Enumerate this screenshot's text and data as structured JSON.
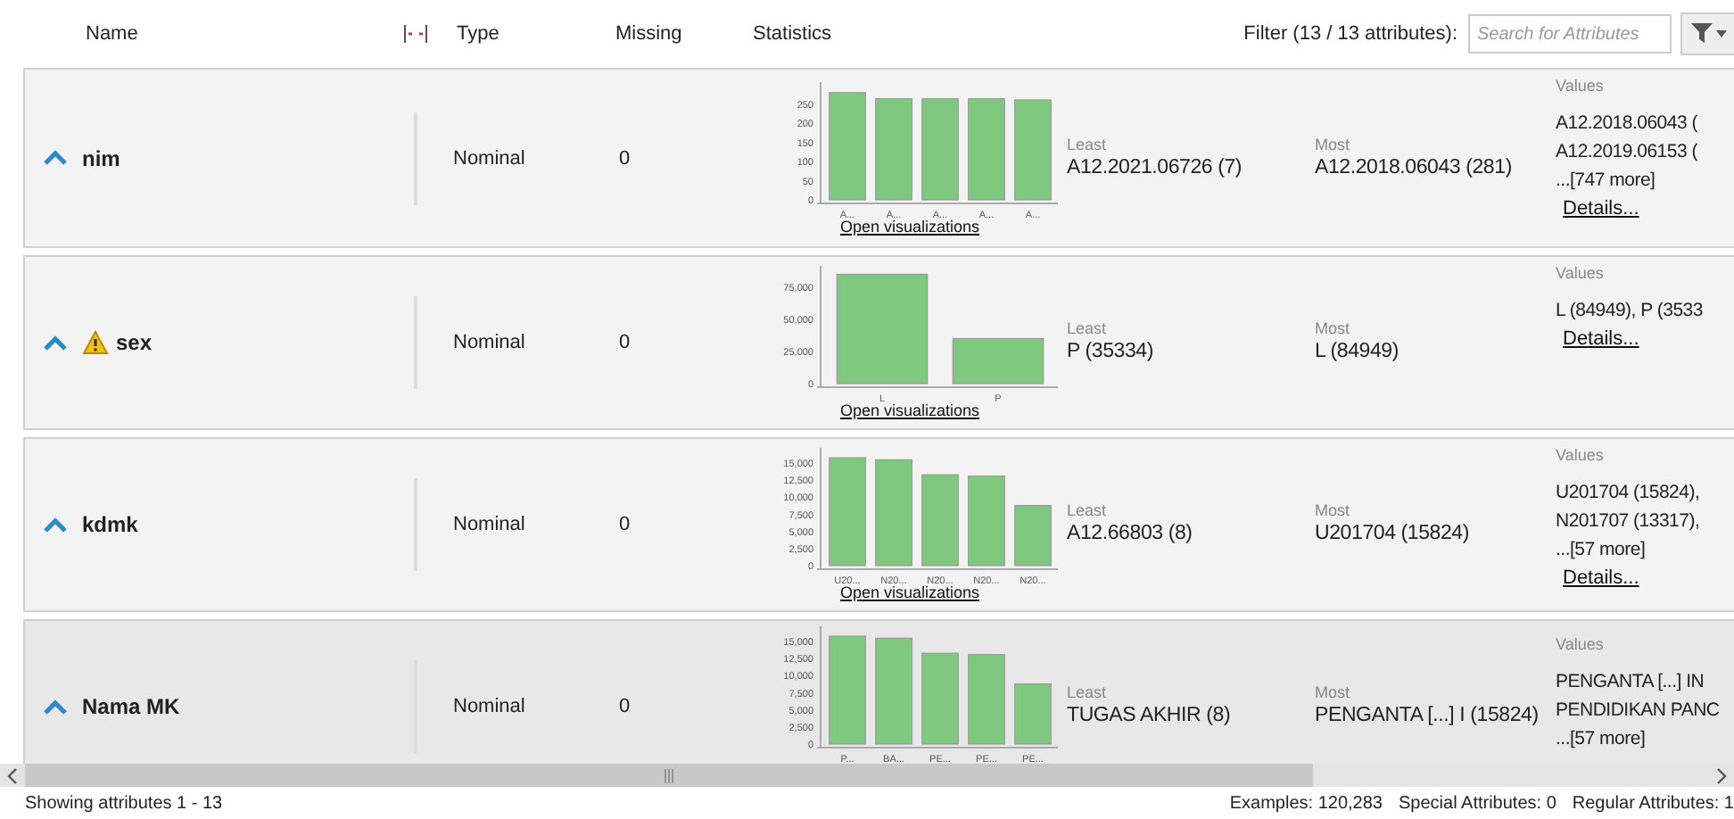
{
  "header": {
    "columns": [
      "Name",
      "Type",
      "Missing",
      "Statistics"
    ],
    "filter_label": "Filter (13 / 13 attributes):",
    "search": {
      "placeholder": "Search for Attributes"
    }
  },
  "attributes": [
    {
      "name": "nim",
      "warning": false,
      "selected": false,
      "type": "Nominal",
      "missing": "0",
      "chart_data": {
        "type": "bar",
        "categories": [
          "A...",
          "A...",
          "A...",
          "A...",
          "A..."
        ],
        "values": [
          281,
          265,
          265,
          265,
          262
        ],
        "ylim": [
          0,
          290
        ],
        "yticks": [
          0,
          50,
          100,
          150,
          200,
          250
        ]
      },
      "link": "Open visualizations",
      "least_label": "Least",
      "least": "A12.2021.06726 (7)",
      "most_label": "Most",
      "most": "A12.2018.06043 (281)",
      "values_label": "Values",
      "values": [
        "A12.2018.06043 (",
        "A12.2019.06153 (",
        "...[747 more]"
      ],
      "details": "Details..."
    },
    {
      "name": "sex",
      "warning": true,
      "selected": false,
      "type": "Nominal",
      "missing": "0",
      "chart_data": {
        "type": "bar",
        "categories": [
          "L",
          "P"
        ],
        "values": [
          85000,
          35000
        ],
        "ylim": [
          0,
          86000
        ],
        "yticks": [
          {
            "value": 0,
            "label": "0"
          },
          {
            "value": 25000,
            "label": "25,000"
          },
          {
            "value": 50000,
            "label": "50,000"
          },
          {
            "value": 75000,
            "label": "75,000"
          }
        ]
      },
      "link": "Open visualizations",
      "least_label": "Least",
      "least": "P (35334)",
      "most_label": "Most",
      "most": "L (84949)",
      "values_label": "Values",
      "values": [
        "L (84949), P (3533"
      ],
      "details": "Details..."
    },
    {
      "name": "kdmk",
      "warning": false,
      "selected": false,
      "type": "Nominal",
      "missing": "0",
      "chart_data": {
        "type": "bar",
        "categories": [
          "U20...",
          "N20...",
          "N20...",
          "N20...",
          "N20..."
        ],
        "values": [
          15800,
          15500,
          13300,
          13100,
          8800
        ],
        "ylim": [
          0,
          16200
        ],
        "yticks": [
          {
            "value": 0,
            "label": "0"
          },
          {
            "value": 2500,
            "label": "2,500"
          },
          {
            "value": 5000,
            "label": "5,000"
          },
          {
            "value": 7500,
            "label": "7,500"
          },
          {
            "value": 10000,
            "label": "10,000"
          },
          {
            "value": 12500,
            "label": "12,500"
          },
          {
            "value": 15000,
            "label": "15,000"
          }
        ]
      },
      "link": "Open visualizations",
      "least_label": "Least",
      "least": "A12.66803 (8)",
      "most_label": "Most",
      "most": "U201704 (15824)",
      "values_label": "Values",
      "values": [
        "U201704 (15824),",
        "N201707 (13317),",
        "...[57 more]"
      ],
      "details": "Details..."
    },
    {
      "name": "Nama MK",
      "warning": false,
      "selected": true,
      "type": "Nominal",
      "missing": "0",
      "chart_data": {
        "type": "bar",
        "categories": [
          "P...",
          "BA...",
          "PE...",
          "PE...",
          "PE..."
        ],
        "values": [
          15800,
          15500,
          13300,
          13100,
          8800
        ],
        "ylim": [
          0,
          16200
        ],
        "yticks": [
          {
            "value": 0,
            "label": "0"
          },
          {
            "value": 2500,
            "label": "2,500"
          },
          {
            "value": 5000,
            "label": "5,000"
          },
          {
            "value": 7500,
            "label": "7,500"
          },
          {
            "value": 10000,
            "label": "10,000"
          },
          {
            "value": 12500,
            "label": "12,500"
          },
          {
            "value": 15000,
            "label": "15,000"
          }
        ]
      },
      "least_label": "Least",
      "least": "TUGAS AKHIR (8)",
      "most_label": "Most",
      "most": "PENGANTA [...] I (15824)",
      "values_label": "Values",
      "values": [
        "PENGANTA [...] IN",
        "PENDIDIKAN PANC",
        "...[57 more]"
      ]
    }
  ],
  "status_bar": {
    "left": "Showing attributes 1 - 13",
    "right": [
      "Examples: 120,283",
      "Special Attributes: 0",
      "Regular Attributes: 1"
    ]
  }
}
